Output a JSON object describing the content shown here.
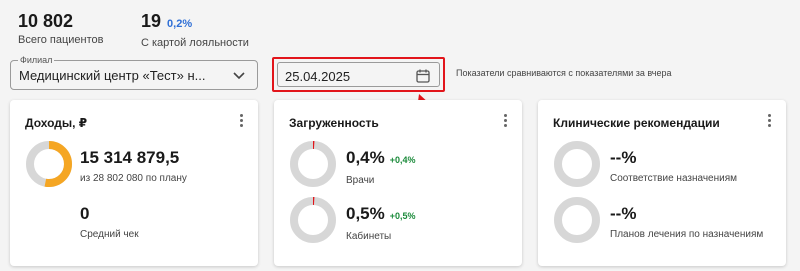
{
  "stats": {
    "patients": {
      "value": "10 802",
      "label": "Всего пациентов"
    },
    "loyalty": {
      "value": "19",
      "percent": "0,2%",
      "label": "С картой лояльности"
    }
  },
  "filters": {
    "branch": {
      "legend": "Филиал",
      "value": "Медицинский центр «Тест» н..."
    },
    "date": {
      "value": "25.04.2025"
    },
    "note": "Показатели сравниваются с показателями за вчера"
  },
  "colors": {
    "accent_orange": "#f5a623",
    "donut_track": "#d7d7d7",
    "positive": "#1a8a3a",
    "highlight": "#e2151b",
    "link_blue": "#2f6fd6"
  },
  "cards": {
    "income": {
      "title": "Доходы, ₽",
      "donut_fill": 0.53,
      "main_value": "15 314 879,5",
      "main_sub": "из 28 802 080 по плану",
      "second_value": "0",
      "second_sub": "Средний чек"
    },
    "load": {
      "title": "Загруженность",
      "doctors": {
        "value": "0,4%",
        "delta": "+0,4%",
        "label": "Врачи",
        "fill": 0.004
      },
      "rooms": {
        "value": "0,5%",
        "delta": "+0,5%",
        "label": "Кабинеты",
        "fill": 0.005
      }
    },
    "clinical": {
      "title": "Клинические рекомендации",
      "compliance": {
        "value": "--%",
        "label": "Соответствие назначениям"
      },
      "plans": {
        "value": "--%",
        "label": "Планов лечения по назначениям"
      }
    }
  }
}
